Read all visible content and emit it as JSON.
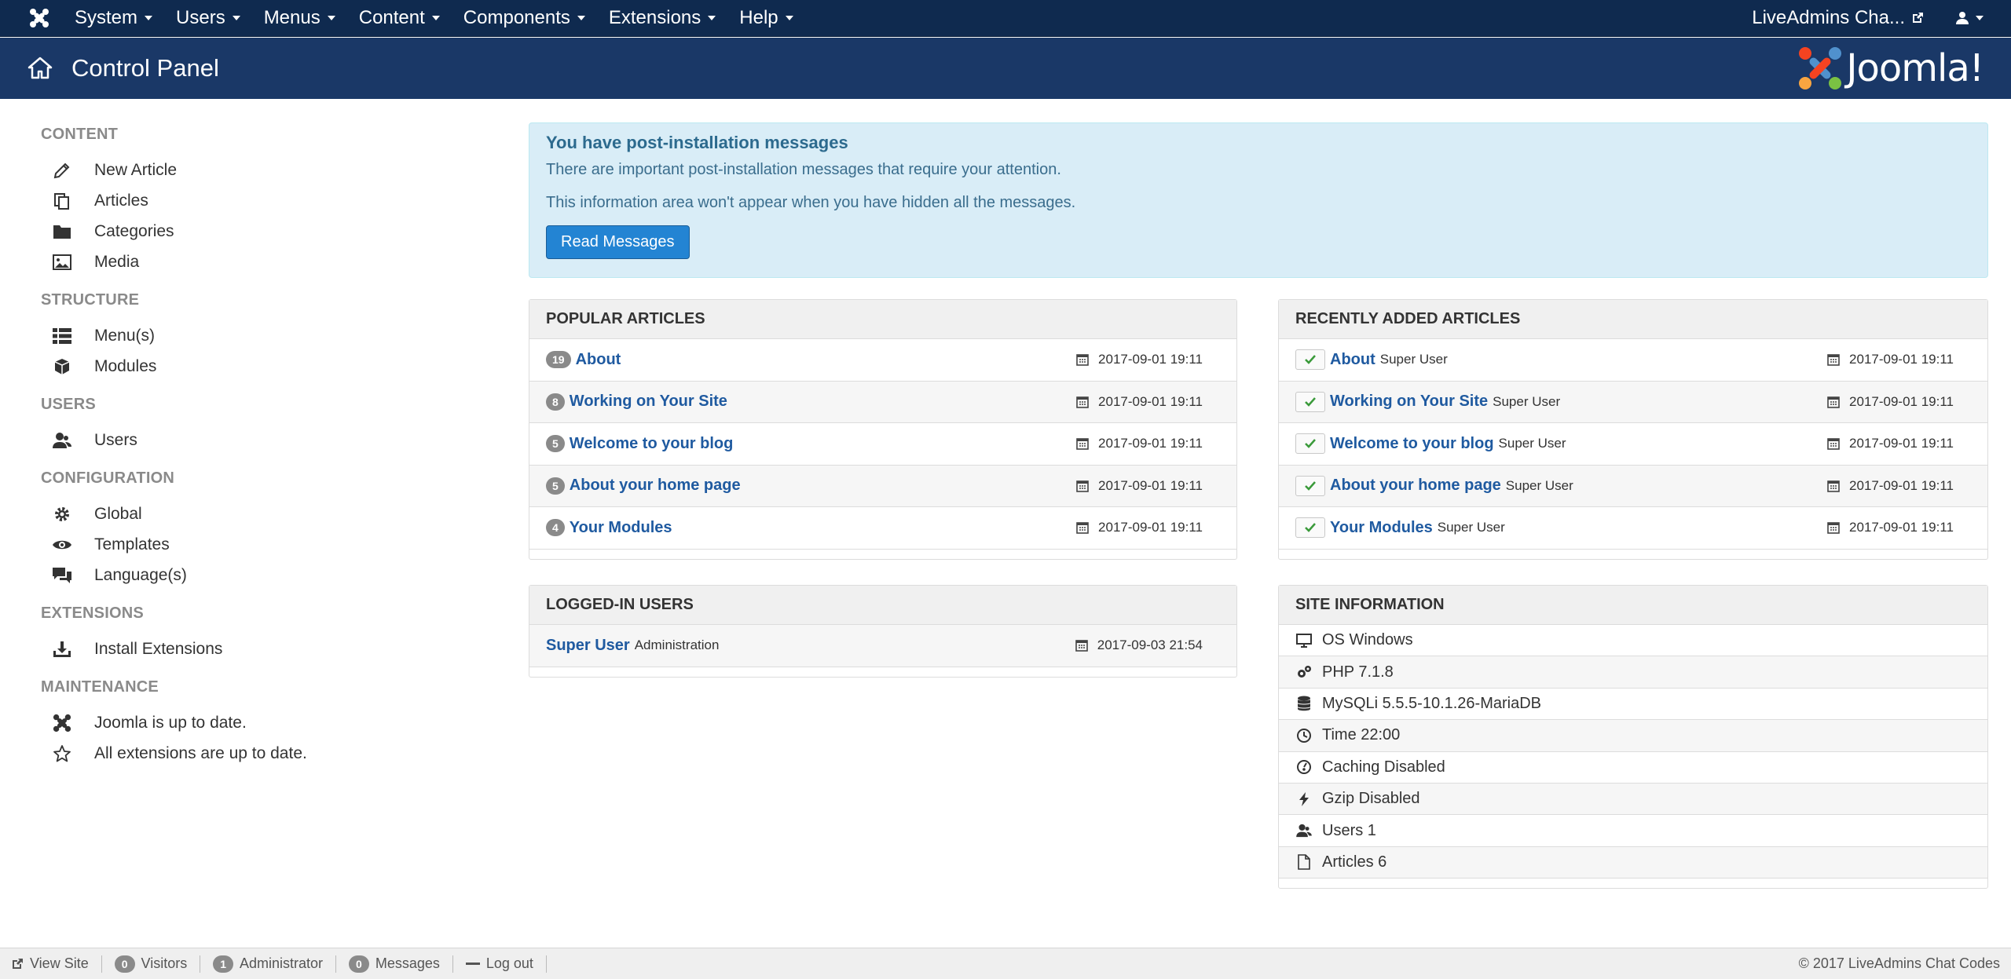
{
  "topbar": {
    "menu": [
      "System",
      "Users",
      "Menus",
      "Content",
      "Components",
      "Extensions",
      "Help"
    ],
    "site_name": "LiveAdmins Cha...",
    "colors": {
      "bg": "#0f2a4f",
      "header": "#1a3867"
    }
  },
  "header": {
    "title": "Control Panel",
    "brand": "Joomla!"
  },
  "sidebar": {
    "sections": [
      {
        "heading": "CONTENT",
        "items": [
          {
            "label": "New Article",
            "icon": "pencil-icon"
          },
          {
            "label": "Articles",
            "icon": "copy-icon"
          },
          {
            "label": "Categories",
            "icon": "folder-icon"
          },
          {
            "label": "Media",
            "icon": "image-icon"
          }
        ]
      },
      {
        "heading": "STRUCTURE",
        "items": [
          {
            "label": "Menu(s)",
            "icon": "list-icon"
          },
          {
            "label": "Modules",
            "icon": "cube-icon"
          }
        ]
      },
      {
        "heading": "USERS",
        "items": [
          {
            "label": "Users",
            "icon": "users-icon"
          }
        ]
      },
      {
        "heading": "CONFIGURATION",
        "items": [
          {
            "label": "Global",
            "icon": "gear-icon"
          },
          {
            "label": "Templates",
            "icon": "eye-icon"
          },
          {
            "label": "Language(s)",
            "icon": "comments-icon"
          }
        ]
      },
      {
        "heading": "EXTENSIONS",
        "items": [
          {
            "label": "Install Extensions",
            "icon": "download-icon"
          }
        ]
      },
      {
        "heading": "MAINTENANCE",
        "items": [
          {
            "label": "Joomla is up to date.",
            "icon": "joomla-icon"
          },
          {
            "label": "All extensions are up to date.",
            "icon": "star-icon"
          }
        ]
      }
    ]
  },
  "alert": {
    "title": "You have post-installation messages",
    "line1": "There are important post-installation messages that require your attention.",
    "line2": "This information area won't appear when you have hidden all the messages.",
    "button": "Read Messages"
  },
  "popular": {
    "heading": "POPULAR ARTICLES",
    "rows": [
      {
        "hits": "19",
        "title": "About",
        "date": "2017-09-01 19:11"
      },
      {
        "hits": "8",
        "title": "Working on Your Site",
        "date": "2017-09-01 19:11"
      },
      {
        "hits": "5",
        "title": "Welcome to your blog",
        "date": "2017-09-01 19:11"
      },
      {
        "hits": "5",
        "title": "About your home page",
        "date": "2017-09-01 19:11"
      },
      {
        "hits": "4",
        "title": "Your Modules",
        "date": "2017-09-01 19:11"
      }
    ]
  },
  "recent": {
    "heading": "RECENTLY ADDED ARTICLES",
    "rows": [
      {
        "title": "About",
        "author": "Super User",
        "date": "2017-09-01 19:11"
      },
      {
        "title": "Working on Your Site",
        "author": "Super User",
        "date": "2017-09-01 19:11"
      },
      {
        "title": "Welcome to your blog",
        "author": "Super User",
        "date": "2017-09-01 19:11"
      },
      {
        "title": "About your home page",
        "author": "Super User",
        "date": "2017-09-01 19:11"
      },
      {
        "title": "Your Modules",
        "author": "Super User",
        "date": "2017-09-01 19:11"
      }
    ]
  },
  "logged": {
    "heading": "LOGGED-IN USERS",
    "rows": [
      {
        "name": "Super User",
        "location": "Administration",
        "date": "2017-09-03 21:54"
      }
    ]
  },
  "siteinfo": {
    "heading": "SITE INFORMATION",
    "rows": [
      {
        "label": "OS Windows",
        "icon": "monitor-icon"
      },
      {
        "label": "PHP 7.1.8",
        "icon": "cogs-icon"
      },
      {
        "label": "MySQLi 5.5.5-10.1.26-MariaDB",
        "icon": "database-icon"
      },
      {
        "label": "Time 22:00",
        "icon": "clock-icon"
      },
      {
        "label": "Caching Disabled",
        "icon": "dashboard-icon"
      },
      {
        "label": "Gzip Disabled",
        "icon": "lightning-icon"
      },
      {
        "label": "Users 1",
        "icon": "users-icon"
      },
      {
        "label": "Articles 6",
        "icon": "file-icon"
      }
    ]
  },
  "statusbar": {
    "view_site": "View Site",
    "visitors_count": "0",
    "visitors_label": "Visitors",
    "admins_count": "1",
    "admins_label": "Administrator",
    "messages_count": "0",
    "messages_label": "Messages",
    "logout": "Log out",
    "copyright": "© 2017 LiveAdmins Chat Codes"
  }
}
